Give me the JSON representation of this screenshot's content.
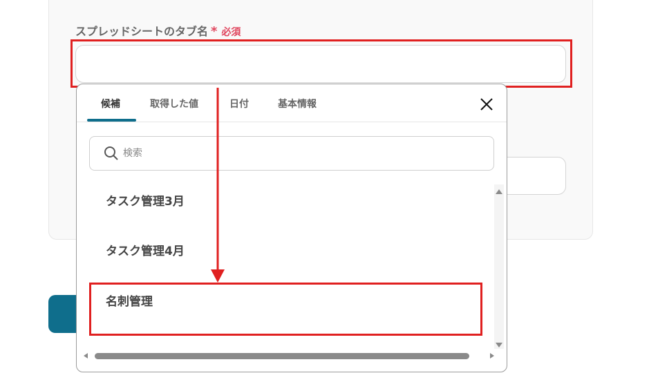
{
  "form": {
    "label": "スプレッドシートのタブ名",
    "required_star": "*",
    "required_text": "必須",
    "value": ""
  },
  "popup": {
    "tabs": [
      {
        "label": "候補",
        "active": true
      },
      {
        "label": "取得した値",
        "active": false
      },
      {
        "label": "日付",
        "active": false
      },
      {
        "label": "基本情報",
        "active": false
      }
    ],
    "close_icon": "close-icon",
    "search": {
      "placeholder": "検索",
      "value": "",
      "icon": "search-icon"
    },
    "items": [
      {
        "label": "タスク管理3月"
      },
      {
        "label": "タスク管理4月"
      },
      {
        "label": "名刺管理"
      }
    ]
  },
  "colors": {
    "accent": "#0f6e8c",
    "highlight": "#e02020",
    "required": "#e0465e"
  }
}
